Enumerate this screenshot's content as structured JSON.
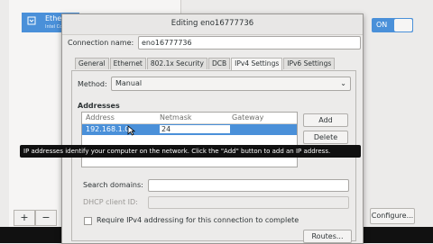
{
  "background": {
    "connection_name": "Etherne",
    "connection_sub": "Intel Corpo",
    "toggle_label": "ON",
    "add_label": "+",
    "remove_label": "−",
    "configure_label": "Configure..."
  },
  "dialog": {
    "title": "Editing eno16777736",
    "connection_name_label": "Connection name:",
    "connection_name_value": "eno16777736",
    "tabs": [
      {
        "label": "General"
      },
      {
        "label": "Ethernet"
      },
      {
        "label": "802.1x Security"
      },
      {
        "label": "DCB"
      },
      {
        "label": "IPv4 Settings"
      },
      {
        "label": "IPv6 Settings"
      }
    ],
    "method_label": "Method:",
    "method_value": "Manual",
    "addresses_label": "Addresses",
    "columns": [
      "Address",
      "Netmask",
      "Gateway"
    ],
    "row": {
      "address": "192.168.1.0",
      "netmask": "24"
    },
    "add_button": "Add",
    "delete_button": "Delete",
    "tooltip": "IP addresses identify your computer on the network.  Click the \"Add\" button to add an IP address.",
    "search_domains_label": "Search domains:",
    "dhcp_client_id_label": "DHCP client ID:",
    "require_ipv4_label": "Require IPv4 addressing for this connection to complete",
    "routes_button": "Routes..."
  },
  "colors": {
    "accent": "#4a90d9",
    "tooltip_bg": "#101010"
  }
}
